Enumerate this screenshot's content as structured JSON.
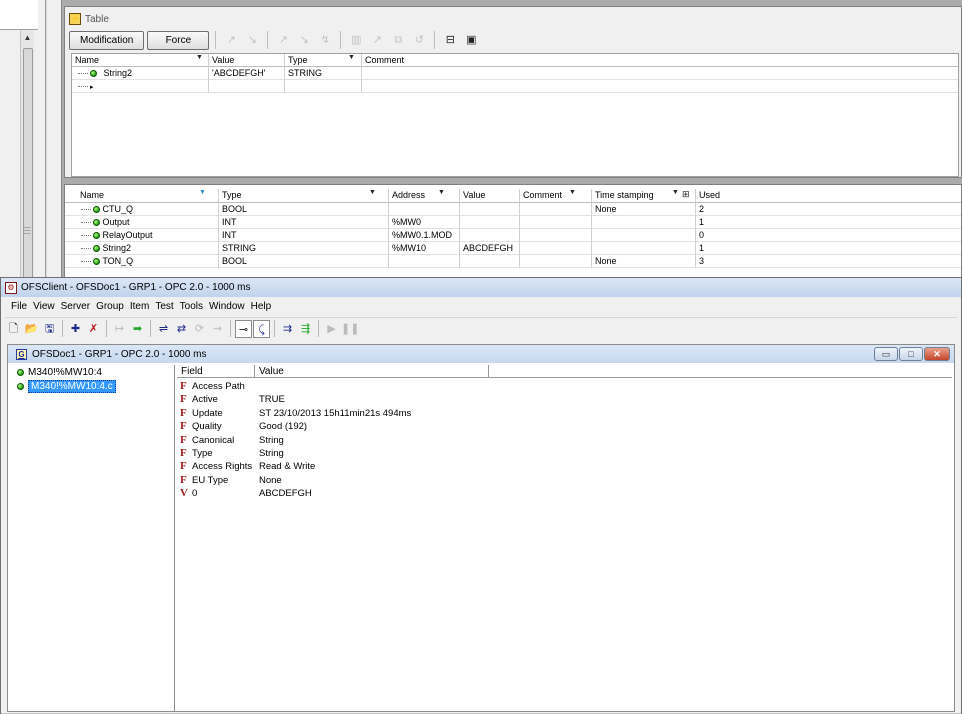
{
  "table_window": {
    "title": "Table",
    "buttons": {
      "modification": "Modification",
      "force": "Force"
    },
    "columns": [
      "Name",
      "Value",
      "Type",
      "Comment"
    ],
    "rows": [
      {
        "name": "String2",
        "value": "'ABCDEFGH'",
        "type": "STRING",
        "comment": ""
      }
    ],
    "new_row_marker": "▸"
  },
  "variables": {
    "columns": [
      "Name",
      "Type",
      "Address",
      "Value",
      "Comment",
      "Time stamping",
      "Used"
    ],
    "rows": [
      {
        "name": "CTU_Q",
        "type": "BOOL",
        "address": "",
        "value": "",
        "comment": "",
        "time_stamping": "None",
        "used": "2"
      },
      {
        "name": "Output",
        "type": "INT",
        "address": "%MW0",
        "value": "",
        "comment": "",
        "time_stamping": "",
        "used": "1"
      },
      {
        "name": "RelayOutput",
        "type": "INT",
        "address": "%MW0.1.MOD",
        "value": "",
        "comment": "",
        "time_stamping": "",
        "used": "0"
      },
      {
        "name": "String2",
        "type": "STRING",
        "address": "%MW10",
        "value": "ABCDEFGH",
        "comment": "",
        "time_stamping": "",
        "used": "1"
      },
      {
        "name": "TON_Q",
        "type": "BOOL",
        "address": "",
        "value": "",
        "comment": "",
        "time_stamping": "None",
        "used": "3"
      }
    ]
  },
  "ofs_client": {
    "title": "OFSClient - OFSDoc1 - GRP1 - OPC 2.0 - 1000 ms",
    "menu": [
      "File",
      "View",
      "Server",
      "Group",
      "Item",
      "Test",
      "Tools",
      "Window",
      "Help"
    ],
    "toolbar_icons": [
      "new-icon",
      "open-icon",
      "save-icon",
      "add-server-icon",
      "remove-server-icon",
      "add-item-icon",
      "refresh-icon",
      "read-icon",
      "write-icon",
      "sync-icon",
      "async-icon",
      "connect-icon",
      "disconnect-icon",
      "play-icon",
      "pause-icon"
    ],
    "doc": {
      "title": "OFSDoc1 - GRP1 - OPC 2.0 - 1000 ms",
      "tree_items": [
        {
          "label": "M340!%MW10:4",
          "selected": false
        },
        {
          "label": "M340!%MW10:4.c",
          "selected": true
        }
      ],
      "columns": [
        "Field",
        "Value"
      ],
      "properties": [
        {
          "icon": "F",
          "field": "Access Path",
          "value": ""
        },
        {
          "icon": "F",
          "field": "Active",
          "value": "TRUE"
        },
        {
          "icon": "F",
          "field": "Update",
          "value": "ST 23/10/2013 15h11min21s 494ms"
        },
        {
          "icon": "F",
          "field": "Quality",
          "value": "Good (192)"
        },
        {
          "icon": "F",
          "field": "Canonical",
          "value": "String"
        },
        {
          "icon": "F",
          "field": "Type",
          "value": "String"
        },
        {
          "icon": "F",
          "field": "Access Rights",
          "value": "Read & Write"
        },
        {
          "icon": "F",
          "field": "EU Type",
          "value": "None"
        },
        {
          "icon": "V",
          "field": "0",
          "value": "ABCDEFGH"
        }
      ]
    }
  }
}
